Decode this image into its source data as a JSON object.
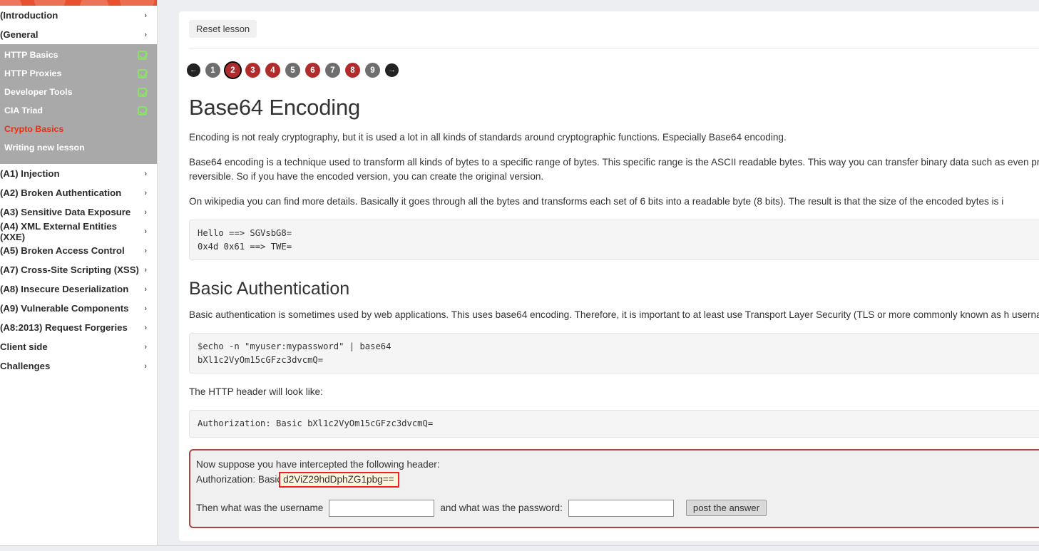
{
  "sidebar": {
    "groups": [
      {
        "label": "(Introduction",
        "chevron": "›"
      },
      {
        "label": "(General",
        "chevron": "›"
      }
    ],
    "general_items": [
      {
        "label": "HTTP Basics",
        "completed": true,
        "active": false
      },
      {
        "label": "HTTP Proxies",
        "completed": true,
        "active": false
      },
      {
        "label": "Developer Tools",
        "completed": true,
        "active": false
      },
      {
        "label": "CIA Triad",
        "completed": true,
        "active": false
      },
      {
        "label": "Crypto Basics",
        "completed": false,
        "active": true
      },
      {
        "label": "Writing new lesson",
        "completed": false,
        "active": false
      }
    ],
    "categories": [
      {
        "label": "(A1) Injection",
        "chevron": "›"
      },
      {
        "label": "(A2) Broken Authentication",
        "chevron": "›"
      },
      {
        "label": "(A3) Sensitive Data Exposure",
        "chevron": "›"
      },
      {
        "label": "(A4) XML External Entities (XXE)",
        "chevron": "›"
      },
      {
        "label": "(A5) Broken Access Control",
        "chevron": "›"
      },
      {
        "label": "(A7) Cross-Site Scripting (XSS)",
        "chevron": "›"
      },
      {
        "label": "(A8) Insecure Deserialization",
        "chevron": "›"
      },
      {
        "label": "(A9) Vulnerable Components",
        "chevron": "›"
      },
      {
        "label": "(A8:2013) Request Forgeries",
        "chevron": "›"
      },
      {
        "label": "Client side",
        "chevron": "›"
      },
      {
        "label": "Challenges",
        "chevron": "›"
      }
    ]
  },
  "toolbar": {
    "reset_label": "Reset lesson"
  },
  "pagination": {
    "prev_glyph": "←",
    "next_glyph": "→",
    "pages": [
      {
        "num": "1",
        "color": "gray",
        "selected": false
      },
      {
        "num": "2",
        "color": "red",
        "selected": true
      },
      {
        "num": "3",
        "color": "red",
        "selected": false
      },
      {
        "num": "4",
        "color": "red",
        "selected": false
      },
      {
        "num": "5",
        "color": "gray",
        "selected": false
      },
      {
        "num": "6",
        "color": "red",
        "selected": false
      },
      {
        "num": "7",
        "color": "gray",
        "selected": false
      },
      {
        "num": "8",
        "color": "red",
        "selected": false
      },
      {
        "num": "9",
        "color": "gray",
        "selected": false
      }
    ]
  },
  "lesson": {
    "title": "Base64 Encoding",
    "para1": "Encoding is not realy cryptography, but it is used a lot in all kinds of standards around cryptographic functions. Especially Base64 encoding.",
    "para2": "Base64 encoding is a technique used to transform all kinds of bytes to a specific range of bytes. This specific range is the ASCII readable bytes. This way you can transfer binary data such as even print these out or write them down. Encoding is also reversible. So if you have the encoded version, you can create the original version.",
    "para3": "On wikipedia you can find more details. Basically it goes through all the bytes and transforms each set of 6 bits into a readable byte (8 bits). The result is that the size of the encoded bytes is i",
    "code1": "Hello ==> SGVsbG8=\n0x4d 0x61 ==> TWE=",
    "subtitle": "Basic Authentication",
    "para4": "Basic authentication is sometimes used by web applications. This uses base64 encoding. Therefore, it is important to at least use Transport Layer Security (TLS or more commonly known as h username password that is sent to the server.",
    "code2": "$echo -n \"myuser:mypassword\" | base64\nbXl1c2VyOm15cGFzc3dvcmQ=",
    "para5": "The HTTP header will look like:",
    "code3": "Authorization: Basic bXl1c2VyOm15cGFzc3dvcmQ="
  },
  "assignment": {
    "intro": "Now suppose you have intercepted the following header:",
    "header_prefix": "Authorization: Basic",
    "header_b64": "d2ViZ29hdDphZG1pbg==",
    "username_label": "Then what was the username",
    "password_label": "and what was the password:",
    "username_value": "",
    "password_value": "",
    "username_placeholder": "",
    "password_placeholder": "",
    "submit_label": "post the answer"
  },
  "colors": {
    "brand_orange": "#e8502e",
    "active_red": "#ea2f10",
    "page_red": "#b02b2b",
    "page_gray": "#6e6e6e",
    "assignment_border": "#a94442",
    "highlight_bg": "#fdf6dd",
    "check_green": "#8ce06a"
  }
}
